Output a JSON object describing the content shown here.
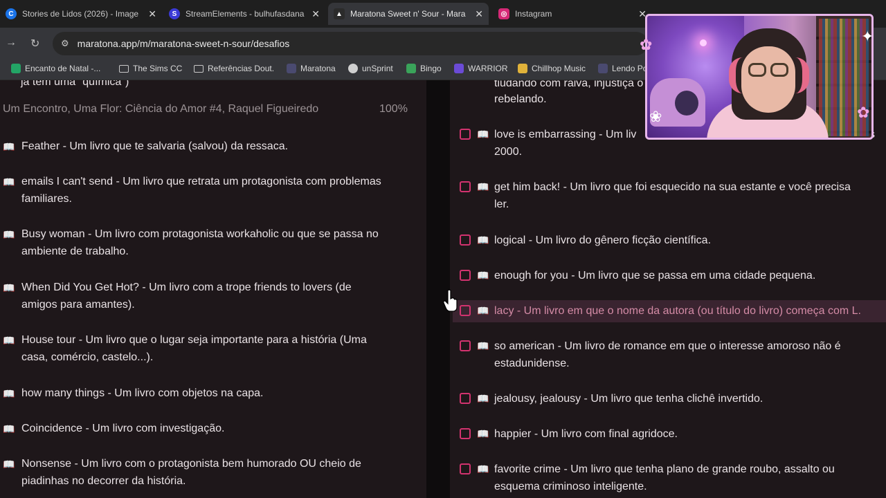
{
  "browser": {
    "tabs": [
      {
        "title": "Stories de Lidos (2026) - Image",
        "icon_color": "#1a73e8",
        "icon": "canva-icon"
      },
      {
        "title": "StreamElements - bulhufasdana",
        "icon_color": "#3b3ad6",
        "icon": "streamelements-icon"
      },
      {
        "title": "Maratona Sweet n' Sour - Mara",
        "icon_color": "#2b2b2b",
        "icon": "maratona-icon"
      },
      {
        "title": "Instagram",
        "icon_color": "#d62976",
        "icon": "instagram-icon"
      }
    ],
    "url": "maratona.app/m/maratona-sweet-n-sour/desafios",
    "bookmarks": [
      {
        "label": "Encanto de Natal -...",
        "kind": "sheets",
        "color": "#23a566"
      },
      {
        "label": "The Sims CC",
        "kind": "folder"
      },
      {
        "label": "Referências Dout.",
        "kind": "folder"
      },
      {
        "label": "Maratona",
        "kind": "site",
        "color": "#2a2a40"
      },
      {
        "label": "unSprint",
        "kind": "site",
        "color": "#cfcfcf"
      },
      {
        "label": "Bingo",
        "kind": "site",
        "color": "#3aa35a"
      },
      {
        "label": "WARRIOR",
        "kind": "site",
        "color": "#6b4bd6"
      },
      {
        "label": "Chillhop Music",
        "kind": "site",
        "color": "#e0b23a"
      },
      {
        "label": "Lendo Po",
        "kind": "site",
        "color": "#2a2a40"
      }
    ]
  },
  "left_column": {
    "cut_text": "já tem uma \"química\")",
    "book_title": "Um Encontro, Uma Flor: Ciência do Amor #4, Raquel Figueiredo",
    "book_progress": "100%",
    "items": [
      {
        "line1": "Feather - Um livro que te salvaria (salvou) da ressaca.",
        "line2": ""
      },
      {
        "line1": "emails I can't send - Um livro que retrata um protagonista com problemas",
        "line2": "familiares."
      },
      {
        "line1": "Busy woman - Um livro com protagonista workaholic ou que se passa no",
        "line2": "ambiente de trabalho."
      },
      {
        "line1": "When Did You Get Hot? - Um livro com a trope friends to lovers (de",
        "line2": "amigos para amantes)."
      },
      {
        "line1": "House tour - Um livro que o lugar seja importante para a história (Uma",
        "line2": "casa, comércio, castelo...)."
      },
      {
        "line1": "how many things - Um livro com objetos na capa.",
        "line2": ""
      },
      {
        "line1": "Coincidence - Um livro com investigação.",
        "line2": ""
      },
      {
        "line1": "Nonsense - Um livro com o protagonista bem humorado OU cheio de",
        "line2": "piadinhas no decorrer da história."
      }
    ]
  },
  "right_column": {
    "cut_text_1": "tiudando com raiva, injustiça o",
    "cut_text_2": "rebelando.",
    "items": [
      {
        "line1": "love is embarrassing - Um liv",
        "line1_tail": "s",
        "line2": "2000."
      },
      {
        "line1": "get him back! - Um livro que foi esquecido na sua estante e você precisa",
        "line1_tail": "",
        "line2": "ler."
      },
      {
        "line1": "logical - Um livro do gênero ficção científica.",
        "line1_tail": "",
        "line2": ""
      },
      {
        "line1": "enough for you - Um livro que se passa em uma cidade pequena.",
        "line1_tail": "",
        "line2": ""
      },
      {
        "line1": "lacy - Um livro em que o nome da autora (ou título do livro) começa com L.",
        "line1_tail": "",
        "line2": ""
      },
      {
        "line1": "so american - Um livro de romance em que o interesse amoroso não é",
        "line1_tail": "",
        "line2": "estadunidense."
      },
      {
        "line1": "jealousy, jealousy - Um livro que tenha clichê invertido.",
        "line1_tail": "",
        "line2": ""
      },
      {
        "line1": "happier - Um livro com final agridoce.",
        "line1_tail": "",
        "line2": ""
      },
      {
        "line1": "favorite crime - Um livro que tenha plano de grande roubo, assalto ou",
        "line1_tail": "",
        "line2": "esquema criminoso inteligente."
      }
    ]
  },
  "colors": {
    "accent": "#d2336f",
    "highlight_row": "#3a2430",
    "text": "#e9e2e5"
  }
}
